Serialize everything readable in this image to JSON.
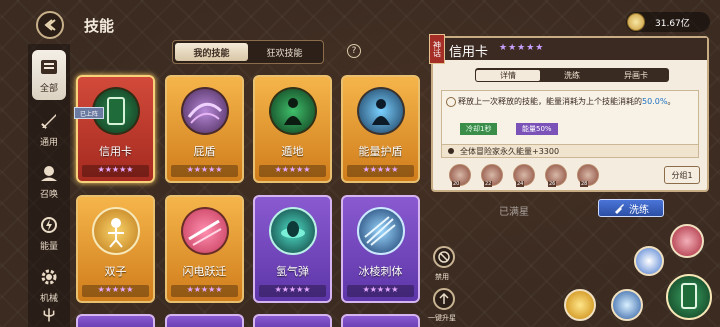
{
  "header": {
    "title": "技能",
    "currency": "31.67亿"
  },
  "sidebar": {
    "items": [
      {
        "label": "全部",
        "icon": "scroll-icon",
        "active": true
      },
      {
        "label": "通用",
        "icon": "sword-icon"
      },
      {
        "label": "召唤",
        "icon": "summon-icon"
      },
      {
        "label": "能量",
        "icon": "energy-icon"
      },
      {
        "label": "机械",
        "icon": "gear-icon"
      }
    ]
  },
  "tabs": [
    {
      "label": "我的技能",
      "active": true
    },
    {
      "label": "狂欢技能",
      "active": false
    }
  ],
  "help": "?",
  "skills": [
    {
      "name": "信用卡",
      "theme": "red",
      "stars": 5,
      "in_use": true
    },
    {
      "name": "屁盾",
      "theme": "gold",
      "stars": 5
    },
    {
      "name": "遁地",
      "theme": "gold",
      "stars": 5
    },
    {
      "name": "能量护盾",
      "theme": "gold",
      "stars": 5
    },
    {
      "name": "双子",
      "theme": "gold",
      "stars": 5
    },
    {
      "name": "闪电跃迁",
      "theme": "gold",
      "stars": 5
    },
    {
      "name": "氢气弹",
      "theme": "purple",
      "stars": 5
    },
    {
      "name": "冰棱刺体",
      "theme": "purple",
      "stars": 5
    }
  ],
  "in_use_badge": "已上阵",
  "side_actions": {
    "ban": "禁用",
    "upgrade": "一键升星"
  },
  "detail": {
    "tag": "神话",
    "name": "信用卡",
    "stars": "★★★★★",
    "tabs": [
      "详情",
      "洗练",
      "异画卡"
    ],
    "desc_pre": "释放上一次释放的技能，能量消耗为上个技能消耗的",
    "desc_highlight": "50.0%",
    "desc_post": "。",
    "chip_cd": "冷却1秒",
    "chip_energy": "能量50%",
    "effect": "全体冒险家永久能量+3300",
    "mini_icons": [
      "20",
      "22",
      "24",
      "26",
      "28"
    ],
    "group_button": "分组1",
    "maxed": "已满星",
    "wash_button": "洗练"
  }
}
